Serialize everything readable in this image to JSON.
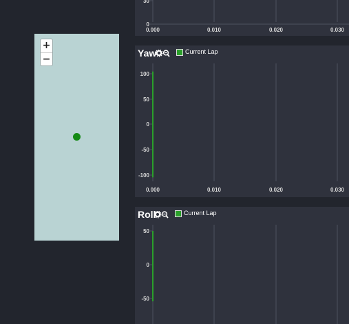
{
  "map": {
    "zoom_in_label": "+",
    "zoom_out_label": "−",
    "background_color": "#b9d3d3",
    "marker_color": "#158a15"
  },
  "charts": [
    {
      "title": "",
      "legend_label": "",
      "x_ticks": [
        "0.000",
        "0.010",
        "0.020",
        "0.030"
      ],
      "y_ticks": [
        "30",
        "0"
      ]
    },
    {
      "title": "Yaw",
      "legend_label": "Current Lap",
      "x_ticks": [
        "0.000",
        "0.010",
        "0.020",
        "0.030"
      ],
      "y_ticks": [
        "100",
        "50",
        "0",
        "-50",
        "-100"
      ]
    },
    {
      "title": "Roll",
      "legend_label": "Current Lap",
      "x_ticks": [
        "0.000",
        "0.010",
        "0.020",
        "0.030"
      ],
      "y_ticks": [
        "50",
        "0",
        "-50"
      ]
    }
  ],
  "chart_data": [
    {
      "type": "line",
      "title": "",
      "xlabel": "",
      "ylabel": "",
      "x_ticks": [
        0.0,
        0.01,
        0.02,
        0.03
      ],
      "y_ticks": [
        0,
        30
      ],
      "grid": true,
      "series": []
    },
    {
      "type": "line",
      "title": "Yaw",
      "xlabel": "",
      "ylabel": "",
      "xlim": [
        0.0,
        0.031
      ],
      "ylim": [
        -110,
        110
      ],
      "grid": true,
      "legend": "top-left",
      "series": [
        {
          "name": "Current Lap",
          "color": "#2aa02a",
          "x": [
            0.0,
            0.0
          ],
          "y": [
            -115,
            115
          ]
        }
      ]
    },
    {
      "type": "line",
      "title": "Roll",
      "xlabel": "",
      "ylabel": "",
      "xlim": [
        0.0,
        0.031
      ],
      "ylim": [
        -60,
        60
      ],
      "grid": true,
      "legend": "top-left",
      "series": [
        {
          "name": "Current Lap",
          "color": "#2aa02a",
          "x": [
            0.0,
            0.0
          ],
          "y": [
            -65,
            60
          ]
        }
      ]
    }
  ]
}
